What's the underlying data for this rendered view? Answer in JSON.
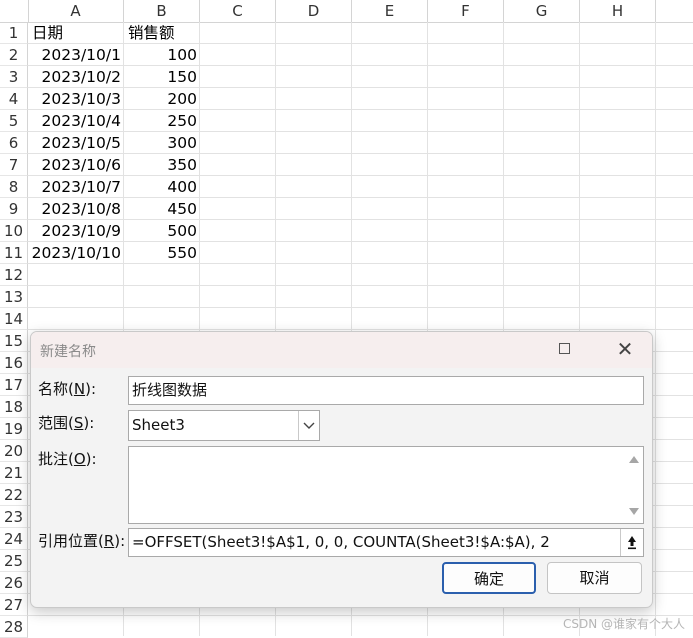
{
  "sheet": {
    "columns": [
      "A",
      "B",
      "C",
      "D",
      "E",
      "F",
      "G",
      "H"
    ],
    "rows": [
      "1",
      "2",
      "3",
      "4",
      "5",
      "6",
      "7",
      "8",
      "9",
      "10",
      "11",
      "12",
      "13",
      "14",
      "15",
      "16",
      "17",
      "18",
      "19",
      "20",
      "21",
      "22",
      "23",
      "24",
      "25",
      "26",
      "27",
      "28"
    ],
    "cells": {
      "header_a": "日期",
      "header_b": "销售额",
      "dates": [
        "2023/10/1",
        "2023/10/2",
        "2023/10/3",
        "2023/10/4",
        "2023/10/5",
        "2023/10/6",
        "2023/10/7",
        "2023/10/8",
        "2023/10/9",
        "2023/10/10"
      ],
      "sales": [
        "100",
        "150",
        "200",
        "250",
        "300",
        "350",
        "400",
        "450",
        "500",
        "550"
      ]
    }
  },
  "dialog": {
    "title": "新建名称",
    "name_label_pre": "名称(",
    "name_label_key": "N",
    "name_label_post": "):",
    "name_value": "折线图数据",
    "scope_label_pre": "范围(",
    "scope_label_key": "S",
    "scope_label_post": "):",
    "scope_value": "Sheet3",
    "comment_label_pre": "批注(",
    "comment_label_key": "O",
    "comment_label_post": "):",
    "comment_value": "",
    "refers_label_pre": "引用位置(",
    "refers_label_key": "R",
    "refers_label_post": "):",
    "refers_value": "=OFFSET(Sheet3!$A$1, 0, 0, COUNTA(Sheet3!$A:$A), 2",
    "ok_label": "确定",
    "cancel_label": "取消",
    "close_glyph": "✕"
  },
  "watermark": "CSDN @谁家有个大人",
  "icons": {
    "maximize": "maximize-icon",
    "close": "close-icon",
    "dropdown": "chevron-down-icon",
    "collapse": "collapse-dialog-icon"
  }
}
